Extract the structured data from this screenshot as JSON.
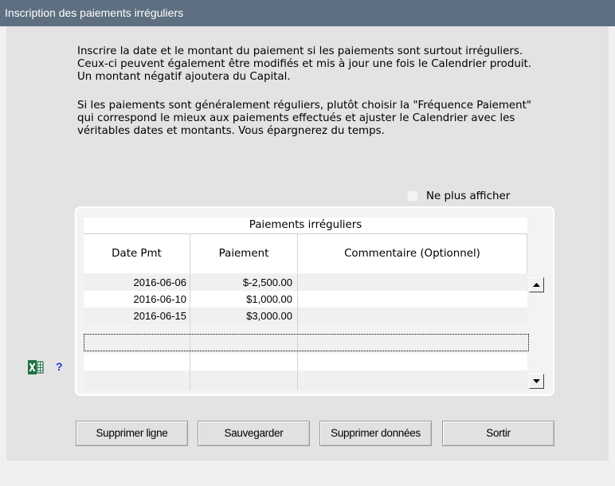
{
  "window": {
    "title": "Inscription des paiements irréguliers"
  },
  "instructions": {
    "para1": "Inscrire la date et le montant du paiement si les paiements sont surtout irréguliers.  Ceux-ci peuvent également être modifiés et mis à jour une fois le Calendrier produit.  Un montant négatif ajoutera du Capital.",
    "para2": "Si les paiements sont généralement réguliers, plutôt choisir la \"Fréquence Paiement\" qui correspond le mieux aux paiements effectués et ajuster le Calendrier avec les véritables dates et montants.  Vous épargnerez du temps."
  },
  "dont_show_again": {
    "label": "Ne plus afficher",
    "checked": false
  },
  "grid": {
    "caption": "Paiements irréguliers",
    "columns": [
      "Date Pmt",
      "Paiement",
      "Commentaire (Optionnel)"
    ],
    "rows": [
      {
        "date": "2016-06-06",
        "amount": "$-2,500.00",
        "comment": ""
      },
      {
        "date": "2016-06-10",
        "amount": "$1,000.00",
        "comment": ""
      },
      {
        "date": "2016-06-15",
        "amount": "$3,000.00",
        "comment": ""
      },
      {
        "date": "",
        "amount": "",
        "comment": ""
      },
      {
        "date": "",
        "amount": "",
        "comment": ""
      },
      {
        "date": "",
        "amount": "",
        "comment": ""
      }
    ]
  },
  "icons": {
    "excel": "excel-icon",
    "help": "?"
  },
  "buttons": {
    "delete_row": "Supprimer ligne",
    "save": "Sauvegarder",
    "delete_data": "Supprimer données",
    "exit": "Sortir"
  },
  "colors": {
    "titlebar": "#5d6f80",
    "help": "#1a3adb",
    "excel": "#1e7145"
  }
}
